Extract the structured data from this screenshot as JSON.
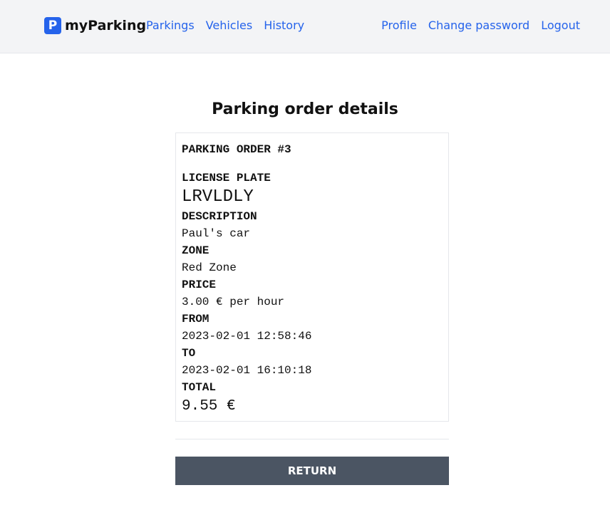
{
  "header": {
    "logo_letter": "P",
    "brand": "myParking",
    "nav_left": [
      "Parkings",
      "Vehicles",
      "History"
    ],
    "nav_right": [
      "Profile",
      "Change password",
      "Logout"
    ]
  },
  "page_title": "Parking order details",
  "order": {
    "title": "PARKING ORDER #3",
    "license_label": "LICENSE PLATE",
    "license_value": "LRVLDLY",
    "description_label": "DESCRIPTION",
    "description_value": "Paul's car",
    "zone_label": "ZONE",
    "zone_value": "Red Zone",
    "price_label": "PRICE",
    "price_value": "3.00 € per hour",
    "from_label": "FROM",
    "from_value": "2023-02-01 12:58:46",
    "to_label": "TO",
    "to_value": "2023-02-01 16:10:18",
    "total_label": "TOTAL",
    "total_value": "9.55 €"
  },
  "return_label": "RETURN",
  "colors": {
    "accent": "#2563eb",
    "button": "#4b5563"
  }
}
